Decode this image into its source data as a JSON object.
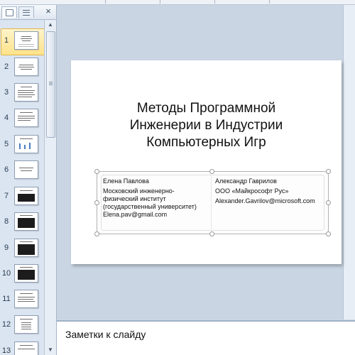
{
  "thumbnails_pane": {
    "tabs": [
      "slides-tab",
      "outline-tab"
    ],
    "close_glyph": "×",
    "slide_numbers": [
      "1",
      "2",
      "3",
      "4",
      "5",
      "6",
      "7",
      "8",
      "9",
      "10",
      "11",
      "12",
      "13"
    ],
    "selected": "1"
  },
  "slide": {
    "title_lines": [
      "Методы Программной",
      "Инженерии  в Индустрии",
      "Компьютерных  Игр"
    ],
    "left_column": {
      "name": "Елена Павлова",
      "affiliation_lines": [
        "Московский  инженерно-",
        "физический  институт",
        "(государственный  университет)"
      ],
      "email": "Elena.pav@gmail.com"
    },
    "right_column": {
      "name": "Александр  Гаврилов",
      "company": "ООО  «Майкрософт  Рус»",
      "email": "Alexander.Gavrilov@microsoft.com"
    }
  },
  "notes": {
    "placeholder": "Заметки к слайду"
  },
  "colors": {
    "selection": "#ffe38a",
    "pane_bg": "#dbe5f1",
    "workspace_bg": "#c9d5e3"
  }
}
